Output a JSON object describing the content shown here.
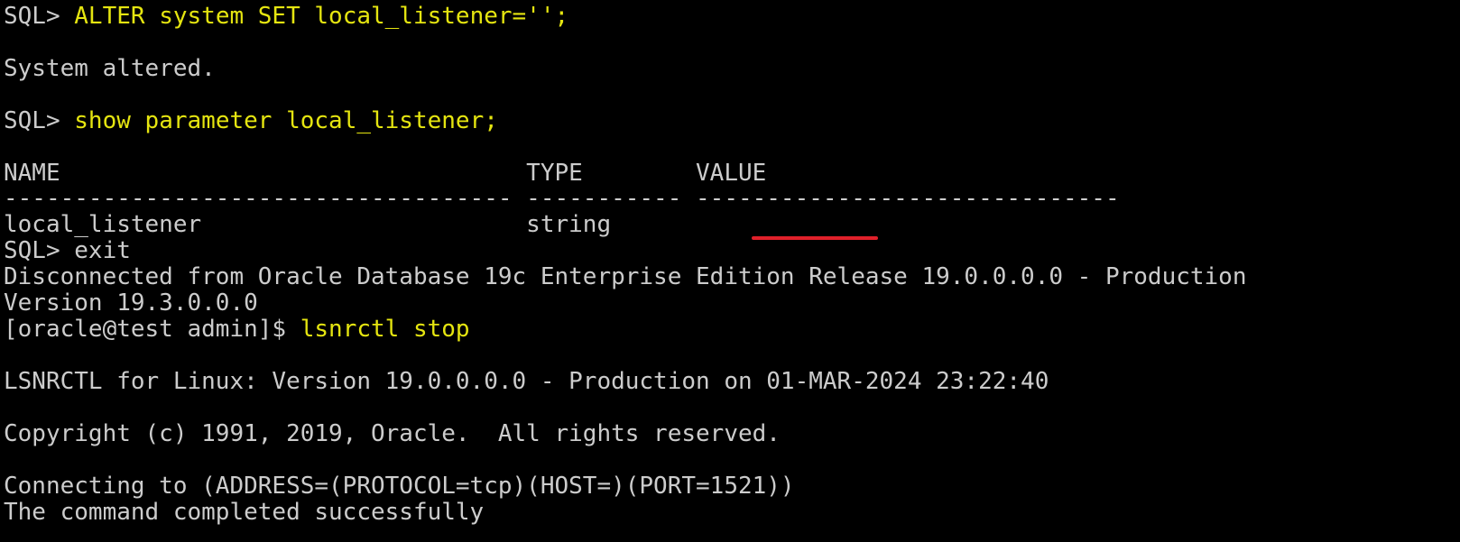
{
  "terminal": {
    "prompt_sql": "SQL> ",
    "lines": {
      "l1_cmd": "ALTER system SET local_listener='';",
      "l2": "System altered.",
      "l3_cmd": "show parameter local_listener;",
      "header": "NAME                                 TYPE        VALUE",
      "divider": "------------------------------------ ----------- ------------------------------",
      "row": "local_listener                       string",
      "l_exit_cmd": "exit",
      "disconnected": "Disconnected from Oracle Database 19c Enterprise Edition Release 19.0.0.0.0 - Production",
      "version": "Version 19.3.0.0.0",
      "shell_prompt": "[oracle@test admin]$ ",
      "lsnr_cmd": "lsnrctl stop",
      "lsnrctl_info": "LSNRCTL for Linux: Version 19.0.0.0.0 - Production on 01-MAR-2024 23:22:40",
      "copyright": "Copyright (c) 1991, 2019, Oracle.  All rights reserved.",
      "connecting": "Connecting to (ADDRESS=(PROTOCOL=tcp)(HOST=)(PORT=1521))",
      "completed": "The command completed successfully"
    },
    "colors": {
      "background": "#000000",
      "output_text": "#cccccc",
      "command_text": "#e5e510",
      "annotation": "#e0202a"
    }
  }
}
